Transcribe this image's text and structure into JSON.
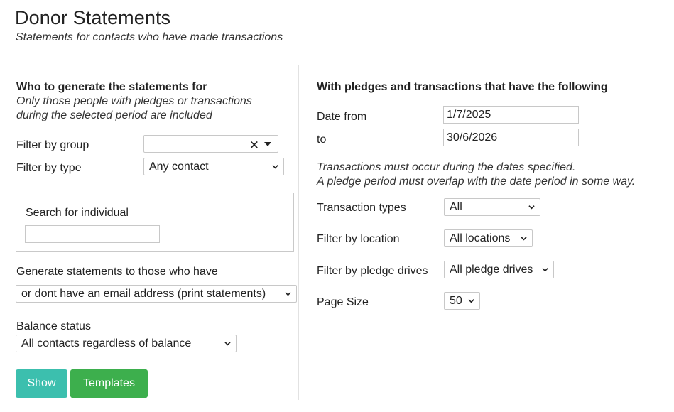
{
  "header": {
    "title": "Donor Statements",
    "subtitle": "Statements for contacts who have made transactions"
  },
  "left": {
    "section_title": "Who to generate the statements for",
    "section_note_1": "Only those people with pledges or transactions",
    "section_note_2": "during the selected period are included",
    "filter_group": {
      "label": "Filter by group",
      "value": ""
    },
    "filter_type": {
      "label": "Filter by type",
      "value": "Any contact"
    },
    "search": {
      "label": "Search for individual",
      "value": ""
    },
    "generate": {
      "label": "Generate statements to those who have",
      "value": "or dont have an email address (print statements)"
    },
    "balance": {
      "label": "Balance status",
      "value": "All contacts regardless of balance"
    }
  },
  "right": {
    "section_title": "With pledges and transactions that have the following",
    "date_from": {
      "label": "Date from",
      "value": "1/7/2025"
    },
    "date_to": {
      "label": "to",
      "value": "30/6/2026"
    },
    "note_1": "Transactions must occur during the dates specified.",
    "note_2": "A pledge period must overlap with the date period in some way.",
    "transaction_types": {
      "label": "Transaction types",
      "value": "All"
    },
    "location": {
      "label": "Filter by location",
      "value": "All locations"
    },
    "pledge_drives": {
      "label": "Filter by pledge drives",
      "value": "All pledge drives"
    },
    "page_size": {
      "label": "Page Size",
      "value": "50"
    }
  },
  "buttons": {
    "show": "Show",
    "templates": "Templates"
  },
  "icons": {
    "clear": "close-icon",
    "dropdown": "chevron-down-icon"
  },
  "colors": {
    "show_button": "#3cbfae",
    "templates_button": "#3daf4d"
  }
}
